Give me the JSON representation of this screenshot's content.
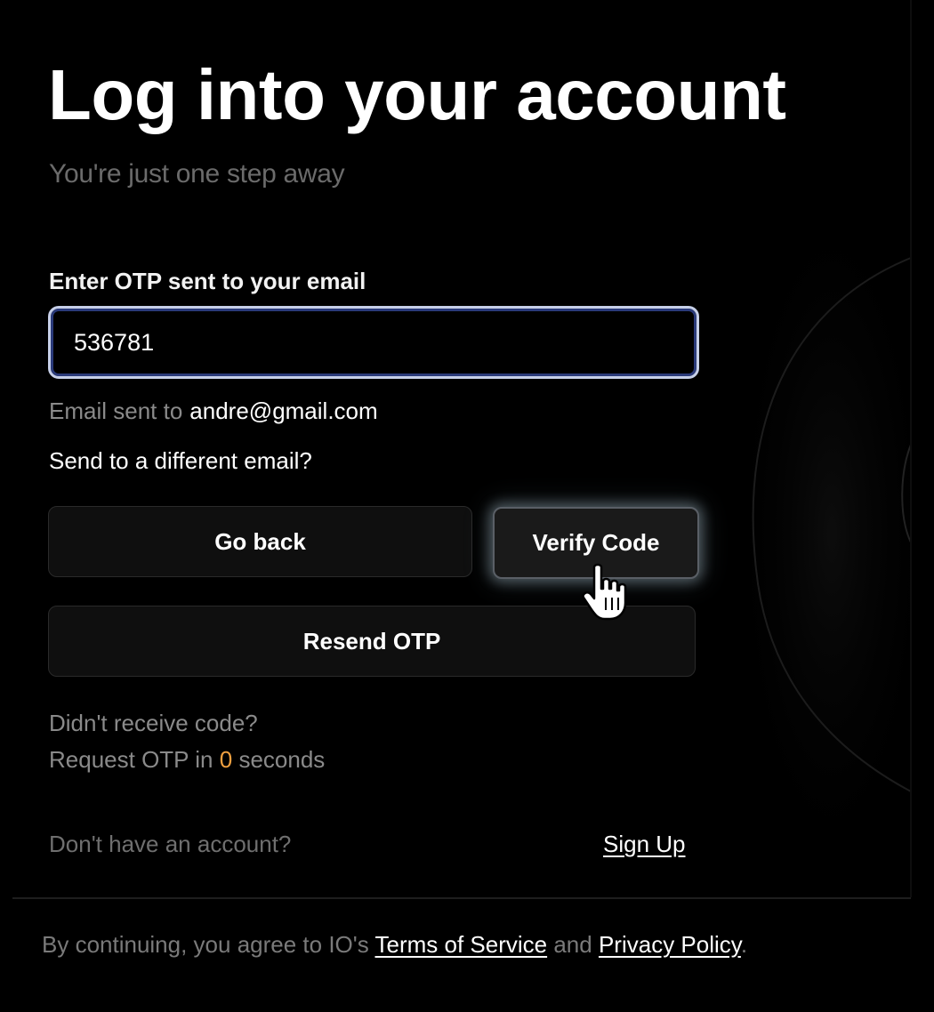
{
  "header": {
    "title": "Log into your account",
    "subtitle": "You're just one step away"
  },
  "otp": {
    "label": "Enter OTP sent to your email",
    "value": "536781",
    "sent_prefix": "Email sent to",
    "sent_email": "andre@gmail.com",
    "different_email": "Send to a different email?"
  },
  "buttons": {
    "go_back": "Go back",
    "verify": "Verify Code",
    "resend": "Resend OTP"
  },
  "resend_info": {
    "didnt_receive": "Didn't receive code?",
    "request_prefix": "Request OTP in",
    "countdown": "0",
    "request_suffix": "seconds"
  },
  "signup": {
    "prompt": "Don't have an account?",
    "link": "Sign Up"
  },
  "footer": {
    "prefix": "By continuing, you agree to IO's",
    "terms": "Terms of Service",
    "and": "and",
    "privacy": "Privacy Policy",
    "period": "."
  },
  "colors": {
    "background": "#000000",
    "countdown_accent": "#f0a040",
    "input_border": "#c6cfe8"
  },
  "icons": {
    "cursor": "hand-pointer-icon"
  }
}
